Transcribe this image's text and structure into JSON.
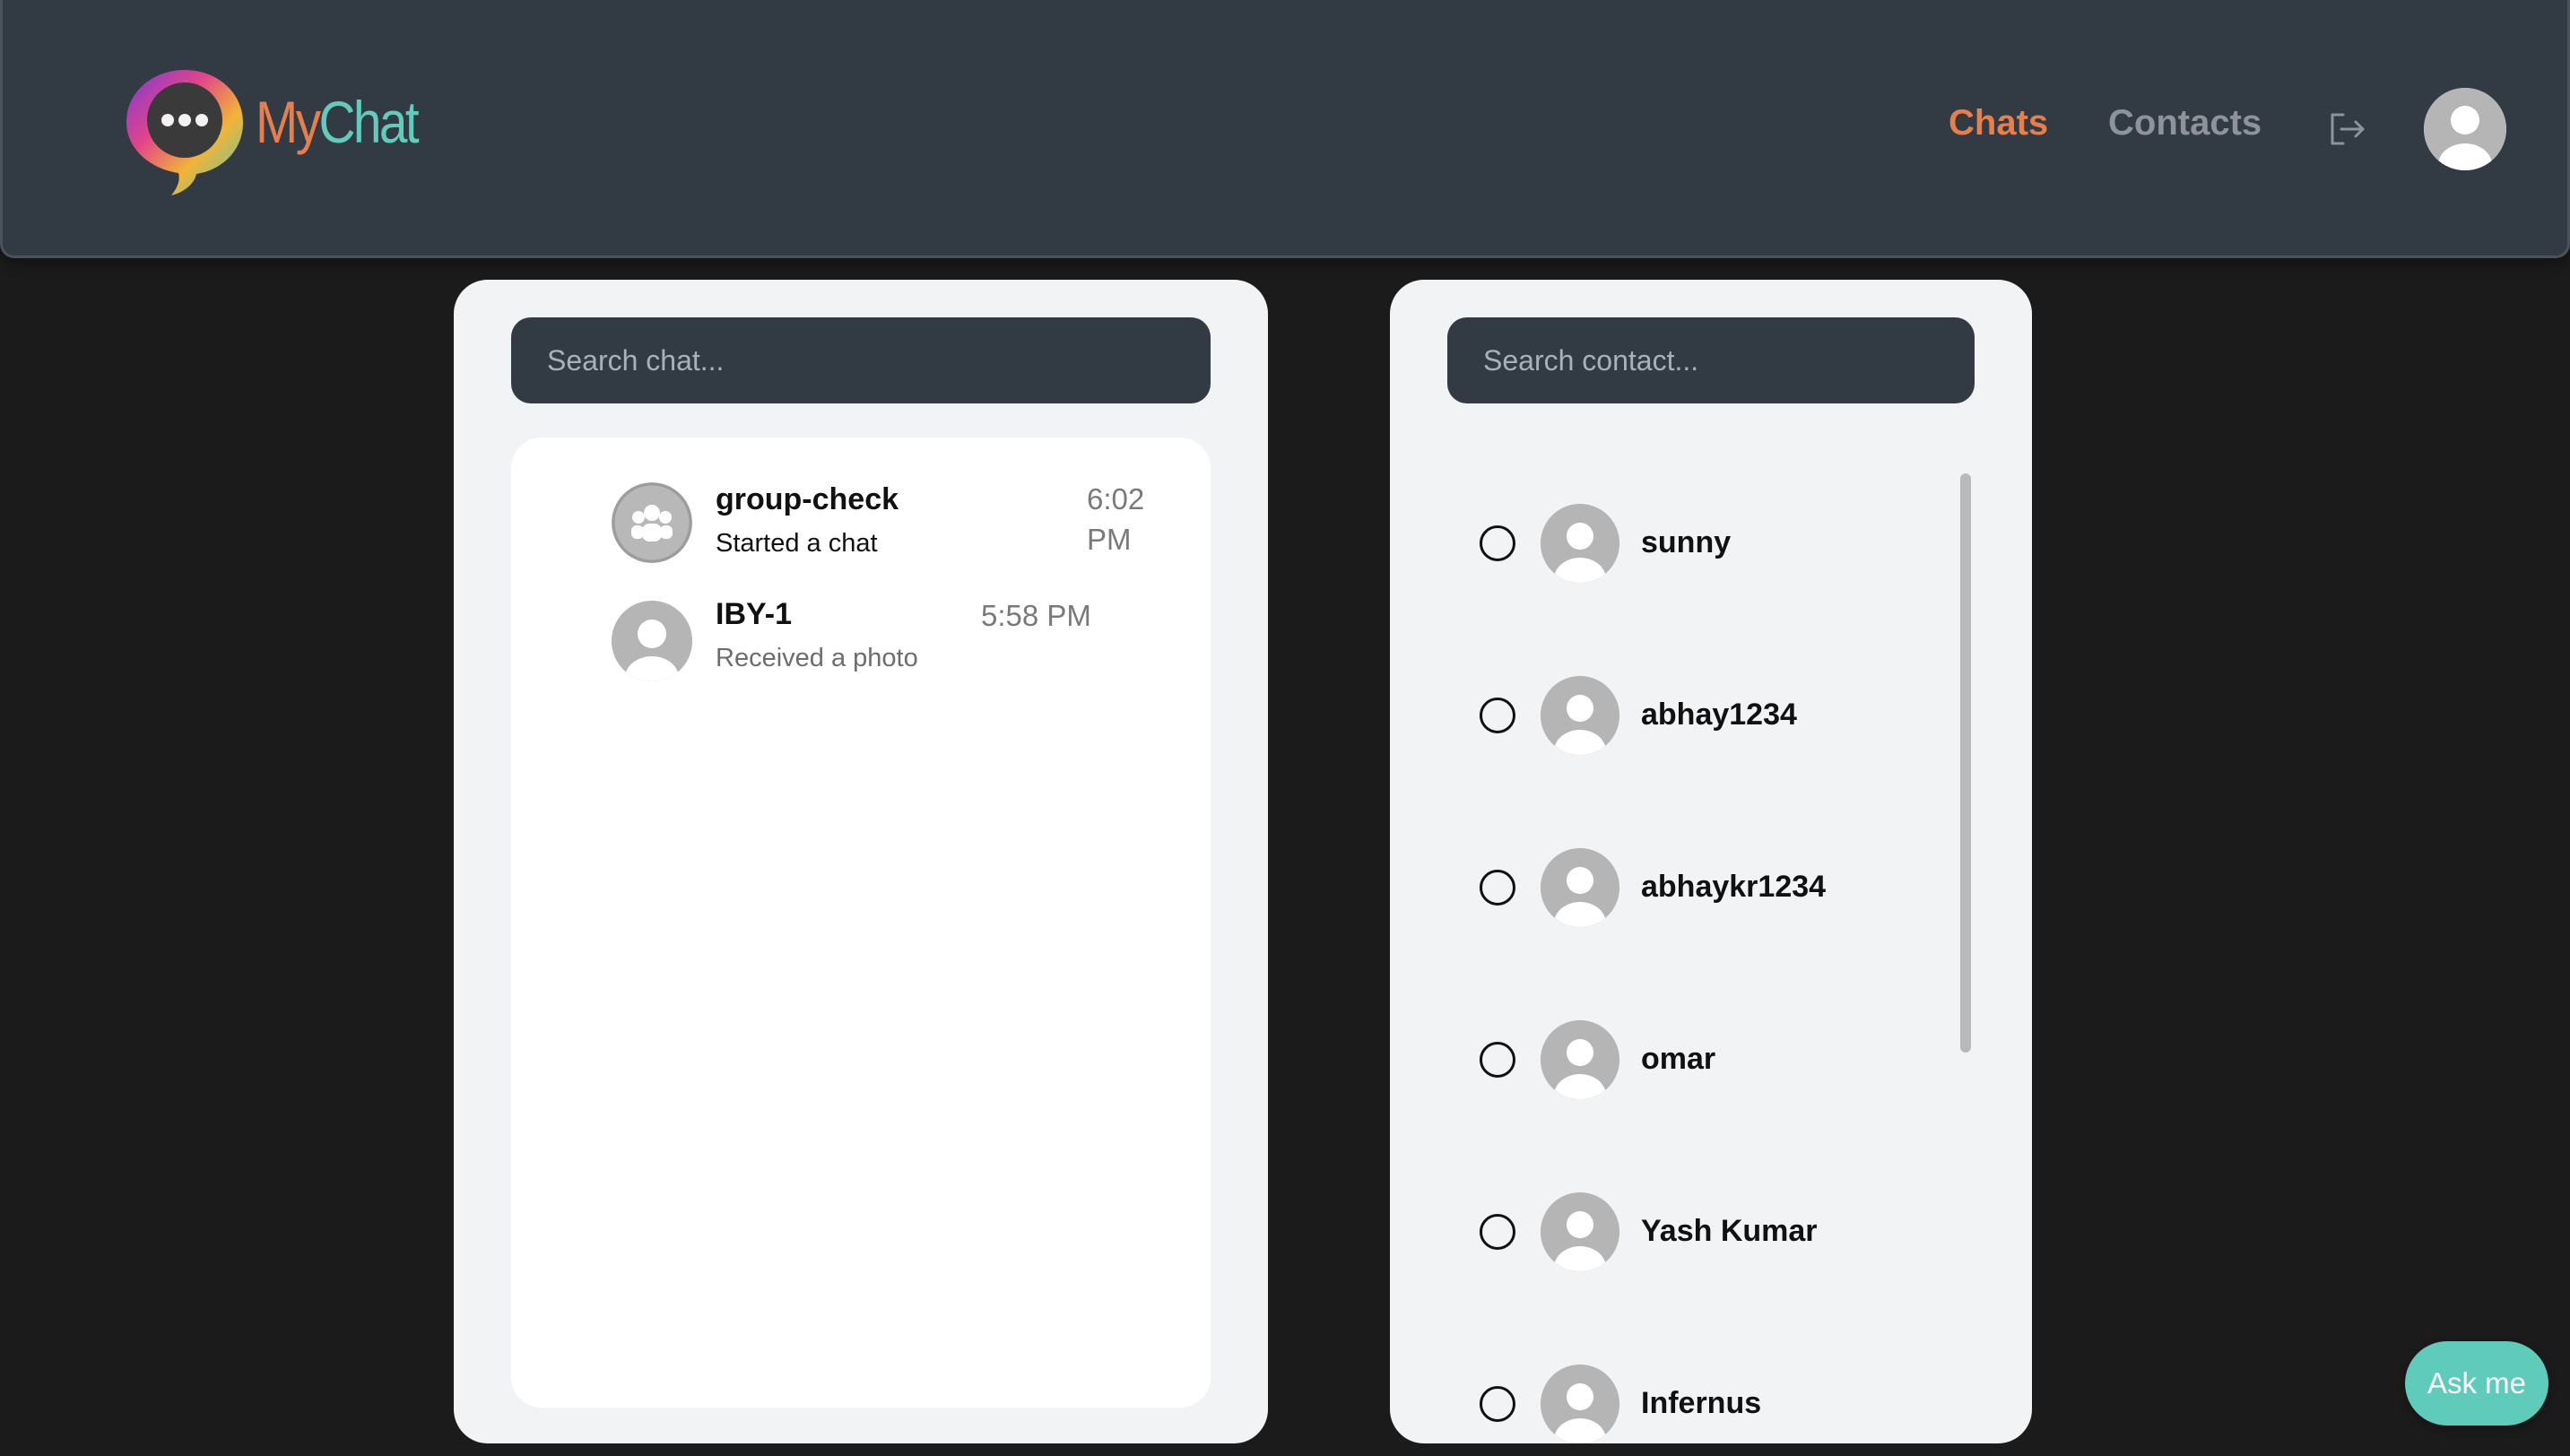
{
  "header": {
    "brand": {
      "part1": "My",
      "part2": "Chat"
    },
    "nav": {
      "chats": "Chats",
      "contacts": "Contacts"
    },
    "icons": {
      "logout": "logout-icon",
      "profile": "user-avatar-icon",
      "logo": "chat-bubble-logo-icon"
    },
    "colors": {
      "accent": "#e77f4d",
      "teal": "#62cbbb",
      "bar": "#323a44"
    }
  },
  "chats": {
    "search_placeholder": "Search chat...",
    "items": [
      {
        "name": "group-check",
        "message": "Started a chat",
        "time_line1": "6:02",
        "time_line2": "PM",
        "avatar": "group-icon"
      },
      {
        "name": "IBY-1",
        "message": "Received a photo",
        "time": "5:58 PM",
        "avatar": "user-icon"
      }
    ]
  },
  "contacts": {
    "search_placeholder": "Search contact...",
    "items": [
      {
        "name": "sunny"
      },
      {
        "name": "abhay1234"
      },
      {
        "name": "abhaykr1234"
      },
      {
        "name": "omar"
      },
      {
        "name": "Yash Kumar"
      },
      {
        "name": "Infernus"
      }
    ]
  },
  "assistant": {
    "label": "Ask me"
  }
}
